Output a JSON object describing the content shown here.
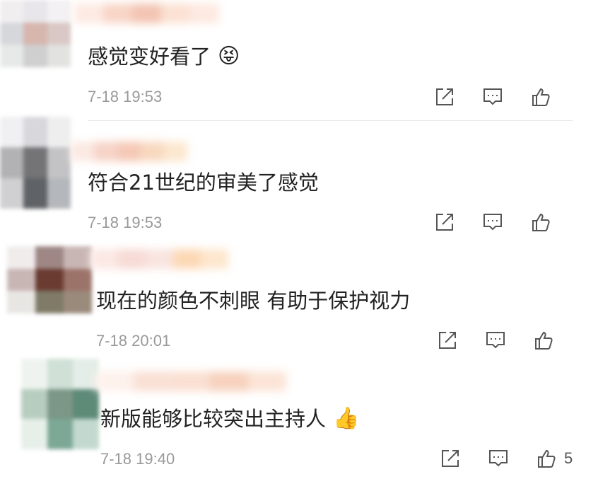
{
  "comments": [
    {
      "text": "感觉变好看了",
      "emoji": "😝",
      "time": "7-18 19:53",
      "colors": {
        "avatar": [
          "#f1eef0",
          "#e8e6ea",
          "#f3f1f3",
          "#d6d7db",
          "#d7b6ae",
          "#d9c8c6",
          "#e7e9e9",
          "#cfcfcf",
          "#e2e2e0"
        ],
        "name": [
          "#fdeae2",
          "#f8d5c7",
          "#f3c4b2",
          "#fbe1d3",
          "#fde9e0"
        ]
      }
    },
    {
      "text": "符合21世纪的审美了感觉",
      "emoji": "",
      "time": "7-18 19:53",
      "colors": {
        "avatar": [
          "#f0f0f2",
          "#d8d8dc",
          "#eeeeef",
          "#b2b2b4",
          "#747476",
          "#c3c3c6",
          "#d0d0d2",
          "#5f6266",
          "#b4b7bb"
        ],
        "name": [
          "#fbe9e3",
          "#f7d3c7",
          "#f5c8b6",
          "#f8d8bf",
          "#fce7cf"
        ]
      }
    },
    {
      "text": "现在的颜色不刺眼 有助于保护视力",
      "emoji": "",
      "time": "7-18 20:01",
      "colors": {
        "avatar": [
          "#f0ecec",
          "#9e8785",
          "#c8b6b4",
          "#c8b6b5",
          "#6a3b31",
          "#9c7369",
          "#e8e6e3",
          "#7f7b68",
          "#9a8a7b"
        ],
        "name": [
          "#fbe8e3",
          "#f7dad5",
          "#f9e4df",
          "#fcd8b4",
          "#fde6cd"
        ]
      }
    },
    {
      "text": "新版能够比较突出主持人",
      "emoji": "👍",
      "time": "7-18 19:40",
      "like_count": "5",
      "colors": {
        "avatar": [
          "#eef3ef",
          "#cfe0d6",
          "#e4ede7",
          "#b7cdbf",
          "#7c9787",
          "#5e8a78",
          "#e7efe9",
          "#7ca895",
          "#c3d9cf"
        ],
        "name": [
          "#fdf1ec",
          "#f9e0d5",
          "#fadfd1",
          "#f7d1bd",
          "#fbe4d6"
        ]
      }
    }
  ],
  "icons": {
    "share": "share-icon",
    "comment": "comment-icon",
    "like": "thumbs-up-icon"
  }
}
